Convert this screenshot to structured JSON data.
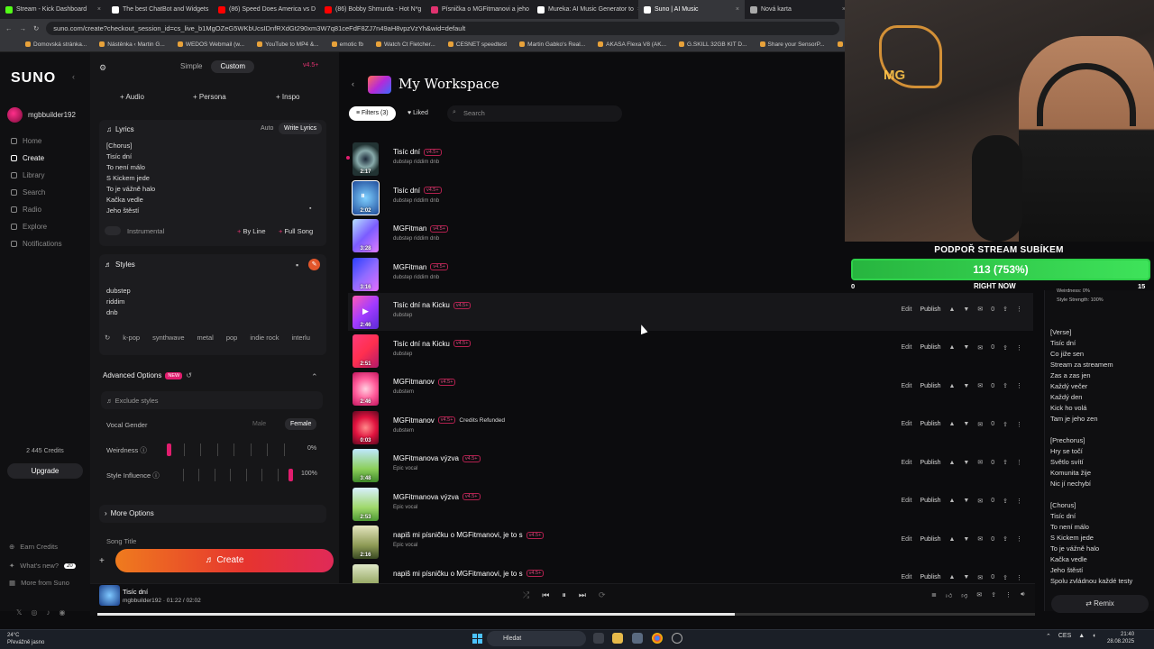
{
  "tabs": [
    {
      "label": "Stream - Kick Dashboard",
      "color": "#53fc18"
    },
    {
      "label": "The best ChatBot and Widgets",
      "color": "#ffffff"
    },
    {
      "label": "(86) Speed Does America vs D",
      "color": "#ff0000"
    },
    {
      "label": "(86) Bobby Shmurda - Hot N*g",
      "color": "#ff0000"
    },
    {
      "label": "Písnička o MGFitmanovi a jeho",
      "color": "#e0326f"
    },
    {
      "label": "Mureka: AI Music Generator to",
      "color": "#ffffff"
    },
    {
      "label": "Suno | AI Music",
      "color": "#ffffff",
      "active": true
    },
    {
      "label": "Nová karta",
      "color": "#aaaaaa"
    }
  ],
  "url": "suno.com/create?checkout_session_id=cs_live_b1MgOZeG5WKbUcsIDnfRXdGt290xm3W7q81ceFdF8ZJ7n49aH8vpzVzYh&wid=default",
  "bookmarks": [
    "Domovská stránka...",
    "Nástěnka ‹ Martin G...",
    "WEDOS Webmail (w...",
    "YouTube to MP4 &...",
    "emotic fb",
    "Watch Ct Fletcher...",
    "CESNET speedtest",
    "Martin Gabko's Real...",
    "AKASA Flexa V8 (AK...",
    "G.SKILL 32GB KIT D...",
    "Share your SensorP...",
    "Define R6 Tempere...",
    "Cross"
  ],
  "nav": {
    "logo": "SUNO",
    "username": "mgbbuilder192",
    "items": [
      "Home",
      "Create",
      "Library",
      "Search",
      "Radio",
      "Explore",
      "Notifications"
    ],
    "credits": "2 445 Credits",
    "upgrade": "Upgrade",
    "earn": "Earn Credits",
    "whats_new": "What's new?",
    "whats_new_count": "20",
    "more": "More from Suno"
  },
  "create": {
    "mode_simple": "Simple",
    "mode_custom": "Custom",
    "version": "v4.5+",
    "audio": "+ Audio",
    "persona": "+ Persona",
    "inspo": "+ Inspo",
    "lyrics_label": "Lyrics",
    "auto": "Auto",
    "write_lyrics": "Write Lyrics",
    "lyrics_lines": [
      "[Chorus]",
      "Tisíc dní",
      "To není málo",
      "S Kickem jede",
      "To je vážně halo",
      "Kačka vedle",
      "Jeho štěstí"
    ],
    "instrumental": "Instrumental",
    "by_line": "By Line",
    "full_song": "Full Song",
    "styles_label": "Styles",
    "styles_lines": [
      "dubstep",
      "riddim",
      "dnb"
    ],
    "chips": [
      "k-pop",
      "synthwave",
      "metal",
      "pop",
      "indie rock",
      "interlu"
    ],
    "advanced": "Advanced Options",
    "new_badge": "NEW",
    "exclude": "Exclude styles",
    "vocal_gender": "Vocal Gender",
    "male": "Male",
    "female": "Female",
    "weirdness": "Weirdness",
    "weirdness_val": "0%",
    "weirdness_level": 0,
    "style_influence": "Style Influence",
    "style_val": "100%",
    "style_level": 100,
    "more_options": "More Options",
    "song_title": "Song Title",
    "create_btn": "Create"
  },
  "workspace": {
    "title": "My Workspace",
    "filters": "Filters (3)",
    "liked": "Liked",
    "search_placeholder": "Search"
  },
  "songs": [
    {
      "title": "Tisíc dní",
      "tag": "v4.5+",
      "sub": "dubstep riddim dnb",
      "dur": "2:17",
      "g": "radial-gradient(circle,#1d2a3a,#8aa 40%,#233 70%)",
      "acts": false
    },
    {
      "title": "Tisíc dní",
      "tag": "v4.5+",
      "sub": "dubstep riddim dnb",
      "dur": "2:02",
      "g": "radial-gradient(circle,#7fd0ff,#1e4a9a)",
      "acts": false,
      "playing": true
    },
    {
      "title": "MGFitman",
      "tag": "v4.5+",
      "sub": "dubstep riddim dnb",
      "dur": "3:28",
      "g": "linear-gradient(135deg,#b5e0ff,#7b5cff,#e07bff)",
      "acts": false
    },
    {
      "title": "MGFitman",
      "tag": "v4.5+",
      "sub": "dubstep riddim dnb",
      "dur": "3:16",
      "g": "linear-gradient(135deg,#2a3fff,#8f6bff,#e46cff)",
      "acts": false
    },
    {
      "title": "Tisíc dní na Kicku",
      "tag": "v4.5+",
      "sub": "dubstep",
      "dur": "2:46",
      "g": "linear-gradient(135deg,#ff5ab5,#a33bff,#5b2cd8)",
      "acts": true,
      "hl": true
    },
    {
      "title": "Tisíc dní na Kicku",
      "tag": "v4.5+",
      "sub": "dubstep",
      "dur": "2:51",
      "g": "linear-gradient(135deg,#ff3b7a,#ff2f4f,#b01a6b)",
      "acts": true
    },
    {
      "title": "MGFitmanov",
      "tag": "v4.5+",
      "sub": "dubstem",
      "dur": "2:46",
      "g": "radial-gradient(circle,#ffd0e0,#ff5c9a,#c2155e)",
      "acts": true
    },
    {
      "title": "MGFitmanov",
      "tag": "v4.5+",
      "sub": "dubstem",
      "dur": "0:03",
      "g": "radial-gradient(circle,#ff8a8a,#e0123e,#5a0820)",
      "acts": true,
      "refund": "Credits Refunded"
    },
    {
      "title": "MGFitmanova výzva",
      "tag": "v4.5+",
      "sub": "Epic vocal",
      "dur": "3:48",
      "g": "linear-gradient(180deg,#bfe8ff,#8ccf5a 60%,#3f8a2a)",
      "acts": true
    },
    {
      "title": "MGFitmanova výzva",
      "tag": "v4.5+",
      "sub": "Epic vocal",
      "dur": "2:53",
      "g": "linear-gradient(180deg,#d8f0ff,#9fd86a 60%,#4e9a33)",
      "acts": true
    },
    {
      "title": "napiš mi písničku o MGFitmanovi, je to s",
      "tag": "v4.5+",
      "sub": "Epic vocal",
      "dur": "2:16",
      "g": "linear-gradient(180deg,#e5e5c0,#8d9a55 60%,#3a4a22)",
      "acts": true
    },
    {
      "title": "napiš mi písničku o MGFitmanovi, je to s",
      "tag": "v4.5+",
      "sub": "",
      "dur": "",
      "g": "linear-gradient(180deg,#dfe8c8,#95a762 60%,#3e5a28)",
      "acts": true
    }
  ],
  "row_actions": {
    "edit": "Edit",
    "publish": "Publish",
    "count": "0"
  },
  "stream": {
    "label": "PODPOŘ STREAM SUBÍKEM",
    "value": "113 (753%)",
    "min": "0",
    "now": "RIGHT NOW",
    "max": "15",
    "fill": 1.0
  },
  "right": {
    "mini1": "Weirdness: 0%",
    "mini2": "Style Strength: 100%",
    "lyrics": "[Verse]\nTisíc dní\nCo jiže sen\nStream za streamem\nZas a zas jen\nKaždý večer\nKaždý den\nKick ho volá\nTam je jeho zen\n\n[Prechorus]\nHry se točí\nSvětlo svítí\nKomunita žije\nNic jí nechybí\n\n[Chorus]\nTisíc dní\nTo není málo\nS Kickem jede\nTo je vážně halo\nKačka vedle\nJeho štěstí\nSpolu zvládnou každé testy",
    "remix": "Remix"
  },
  "player": {
    "title": "Tisíc dní",
    "user": "mgbbuilder192",
    "time": "01:22",
    "total": "02:02",
    "progress": 0.68
  },
  "taskbar": {
    "temp": "24°C",
    "weather": "Převážně jasno",
    "search": "Hledat",
    "lang": "CES",
    "time": "21:40",
    "date": "28.08.2025"
  }
}
